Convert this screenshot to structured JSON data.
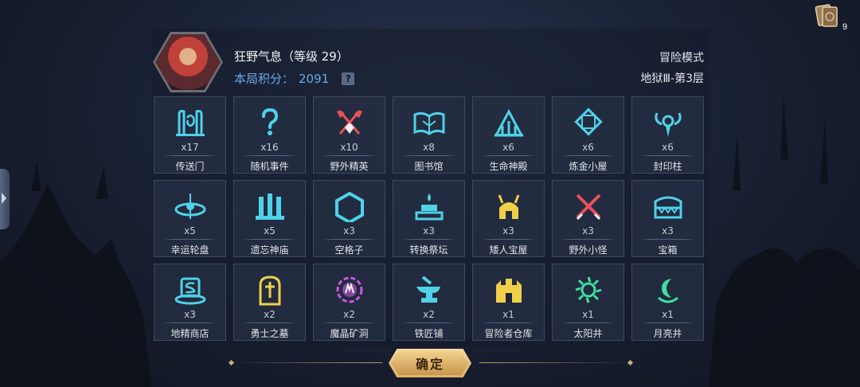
{
  "card_badge": {
    "count": "9",
    "icon": "card-deck-icon"
  },
  "player": {
    "name": "狂野气息（等级 29）",
    "score_label": "本局积分：",
    "score_value": "2091",
    "help": "?"
  },
  "mode": "冒险模式",
  "floor": "地狱Ⅲ-第3层",
  "tiles": [
    {
      "count": "x17",
      "label": "传送门",
      "icon": "portal-icon",
      "color": "#4fd2e8"
    },
    {
      "count": "x16",
      "label": "随机事件",
      "icon": "question-icon",
      "color": "#4fd2e8"
    },
    {
      "count": "x10",
      "label": "野外精英",
      "icon": "crossed-axes-icon",
      "color": "#e8505a"
    },
    {
      "count": "x8",
      "label": "图书馆",
      "icon": "book-icon",
      "color": "#4fd2e8"
    },
    {
      "count": "x6",
      "label": "生命神殿",
      "icon": "temple-icon",
      "color": "#4fd2e8"
    },
    {
      "count": "x6",
      "label": "炼金小屋",
      "icon": "alchemy-icon",
      "color": "#4fd2e8"
    },
    {
      "count": "x6",
      "label": "封印柱",
      "icon": "seal-pillar-icon",
      "color": "#4fd2e8"
    },
    {
      "count": "x5",
      "label": "幸运轮盘",
      "icon": "wheel-icon",
      "color": "#4fd2e8"
    },
    {
      "count": "x5",
      "label": "遗忘神庙",
      "icon": "shrine-icon",
      "color": "#4fd2e8"
    },
    {
      "count": "x3",
      "label": "空格子",
      "icon": "hexagon-icon",
      "color": "#4fd2e8"
    },
    {
      "count": "x3",
      "label": "转换祭坛",
      "icon": "altar-icon",
      "color": "#4fd2e8"
    },
    {
      "count": "x3",
      "label": "矮人宝屋",
      "icon": "viking-helmet-icon",
      "color": "#f0d048"
    },
    {
      "count": "x3",
      "label": "野外小怪",
      "icon": "crossed-swords-icon",
      "color": "#e8505a"
    },
    {
      "count": "x3",
      "label": "宝箱",
      "icon": "mimic-chest-icon",
      "color": "#4fd2e8"
    },
    {
      "count": "x3",
      "label": "地精商店",
      "icon": "goblin-shop-icon",
      "color": "#4fd2e8"
    },
    {
      "count": "x2",
      "label": "勇士之墓",
      "icon": "tombstone-icon",
      "color": "#f0d048"
    },
    {
      "count": "x2",
      "label": "魔晶矿洞",
      "icon": "crystal-mine-icon",
      "color": "#c85ae0"
    },
    {
      "count": "x2",
      "label": "铁匠铺",
      "icon": "anvil-icon",
      "color": "#4fd2e8"
    },
    {
      "count": "x1",
      "label": "冒险者仓库",
      "icon": "warehouse-icon",
      "color": "#f0d048"
    },
    {
      "count": "x1",
      "label": "太阳井",
      "icon": "sun-well-icon",
      "color": "#3ee0a0"
    },
    {
      "count": "x1",
      "label": "月亮井",
      "icon": "moon-well-icon",
      "color": "#3ee0a0"
    }
  ],
  "confirm_label": "确定"
}
